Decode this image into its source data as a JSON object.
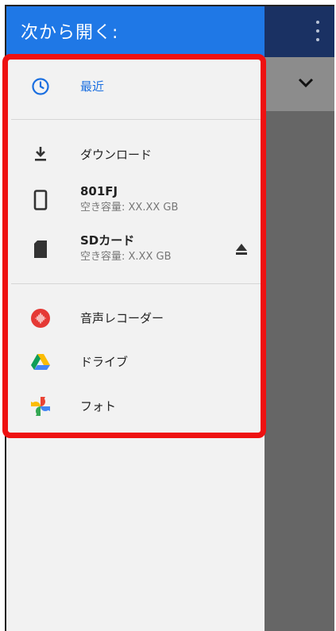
{
  "drawer": {
    "title": "次から開く:",
    "recent": {
      "label": "最近",
      "icon": "clock-icon"
    },
    "storage": [
      {
        "label": "ダウンロード",
        "icon": "download-icon"
      },
      {
        "label": "801FJ",
        "sub": "空き容量: XX.XX GB",
        "icon": "phone-icon"
      },
      {
        "label": "SDカード",
        "sub": "空き容量: X.XX GB",
        "icon": "sd-card-icon",
        "action_icon": "eject-icon"
      }
    ],
    "apps": [
      {
        "label": "音声レコーダー",
        "icon": "voice-recorder-icon"
      },
      {
        "label": "ドライブ",
        "icon": "drive-icon"
      },
      {
        "label": "フォト",
        "icon": "photos-icon"
      }
    ]
  },
  "background_app": {
    "menu_icon": "kebab-icon",
    "expand_icon": "chevron-down-icon"
  },
  "colors": {
    "header": "#1f78e6",
    "highlight": "#ee1111",
    "accent": "#1b6fe0"
  }
}
